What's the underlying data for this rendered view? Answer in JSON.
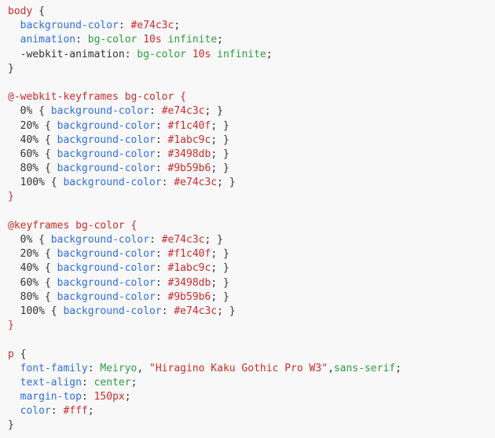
{
  "code": {
    "body_selector": "body",
    "body_open_brace": " {",
    "body_bg_prop": "background-color",
    "body_bg_val": "#e74c3c",
    "body_anim_prop": "animation",
    "body_anim_name": "bg-color",
    "body_anim_dur": "10s",
    "body_anim_iter": "infinite",
    "body_webkit_anim_prop": "-webkit-animation",
    "close_brace": "}",
    "webkit_kf_rule": "@-webkit-keyframes",
    "kf_rule": "@keyframes",
    "kf_name": "bg-color",
    "open_brace": " {",
    "frames": [
      {
        "pct": "0%",
        "color": "#e74c3c"
      },
      {
        "pct": "20%",
        "color": "#f1c40f"
      },
      {
        "pct": "40%",
        "color": "#1abc9c"
      },
      {
        "pct": "60%",
        "color": "#3498db"
      },
      {
        "pct": "80%",
        "color": "#9b59b6"
      },
      {
        "pct": "100%",
        "color": "#e74c3c"
      }
    ],
    "bg_prop": "background-color",
    "p_selector": "p",
    "p_font_prop": "font-family",
    "p_font_v1": "Meiryo",
    "p_font_v2": "\"Hiragino Kaku Gothic Pro W3\"",
    "p_font_v3": "sans-serif",
    "p_align_prop": "text-align",
    "p_align_val": "center",
    "p_margin_prop": "margin-top",
    "p_margin_val": "150px",
    "p_color_prop": "color",
    "p_color_val": "#fff",
    "colon_sp": ": ",
    "semi": ";",
    "comma_sp": ", ",
    "comma": ",",
    "sp": " ",
    "indent": "  ",
    "frame_open": " { ",
    "frame_close": "; }"
  }
}
